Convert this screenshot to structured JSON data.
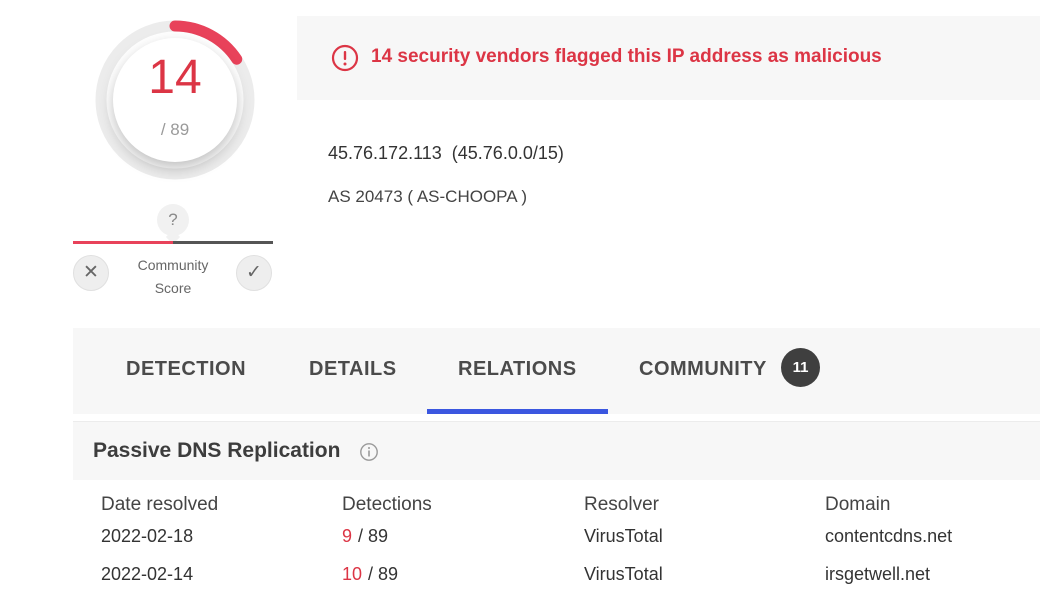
{
  "score": {
    "value": "14",
    "total": "/ 89",
    "detected_fraction": 0.157
  },
  "community_score": {
    "indicator": "?",
    "label_line1": "Community",
    "label_line2": "Score",
    "downvote_icon": "✕",
    "upvote_icon": "✓",
    "score_fraction": 0.5
  },
  "alert": {
    "icon": "alert-circle-icon",
    "text": "14 security vendors flagged this IP address as malicious"
  },
  "ip": {
    "address": "45.76.172.113",
    "range": "(45.76.0.0/15)",
    "asn": "AS 20473 ( AS-CHOOPA )"
  },
  "tabs": [
    {
      "label": "DETECTION"
    },
    {
      "label": "DETAILS"
    },
    {
      "label": "RELATIONS",
      "active": true
    },
    {
      "label": "COMMUNITY",
      "badge": "11"
    }
  ],
  "passive_dns": {
    "title": "Passive DNS Replication",
    "columns": [
      "Date resolved",
      "Detections",
      "Resolver",
      "Domain"
    ],
    "rows": [
      {
        "date": "2022-02-18",
        "detections": "9",
        "total": "/ 89",
        "resolver": "VirusTotal",
        "domain": "contentcdns.net"
      },
      {
        "date": "2022-02-14",
        "detections": "10",
        "total": "/ 89",
        "resolver": "VirusTotal",
        "domain": "irsgetwell.net"
      }
    ]
  },
  "colors": {
    "malicious": "#dc3545",
    "accent_tab": "#3b57e0",
    "gauge_track": "#ececec",
    "gauge_fill": "#e8425a"
  }
}
